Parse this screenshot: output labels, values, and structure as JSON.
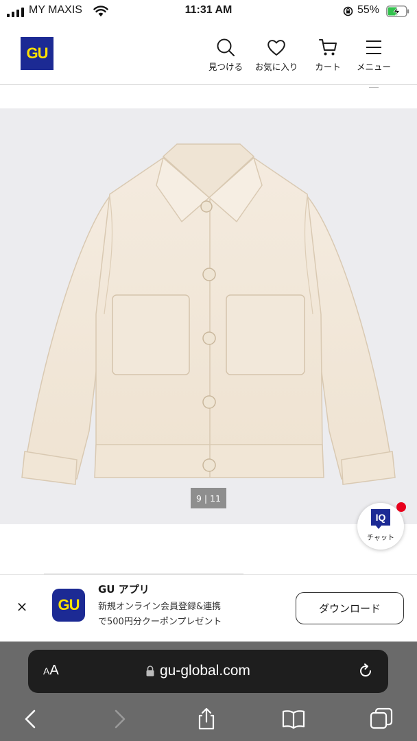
{
  "status_bar": {
    "carrier": "MY MAXIS",
    "time": "11:31 AM",
    "battery": "55%"
  },
  "header": {
    "logo": "GU",
    "nav": {
      "search": "見つける",
      "favorites": "お気に入り",
      "cart": "カート",
      "menu": "メニュー"
    }
  },
  "product": {
    "image_counter": "9 | 11",
    "chat": {
      "badge": "IQ",
      "label": "チャット"
    }
  },
  "app_banner": {
    "close": "×",
    "icon_text": "GU",
    "title": "GU アプリ",
    "desc_line1": "新規オンライン会員登録&連携",
    "desc_line2": "で500円分クーポンプレゼント",
    "download": "ダウンロード"
  },
  "safari": {
    "aa_small": "A",
    "aa_large": "A",
    "url": "gu-global.com"
  },
  "colors": {
    "brand_navy": "#1c2a94",
    "brand_yellow": "#ffe100",
    "notification_red": "#e8001c",
    "image_bg": "#ececef"
  }
}
